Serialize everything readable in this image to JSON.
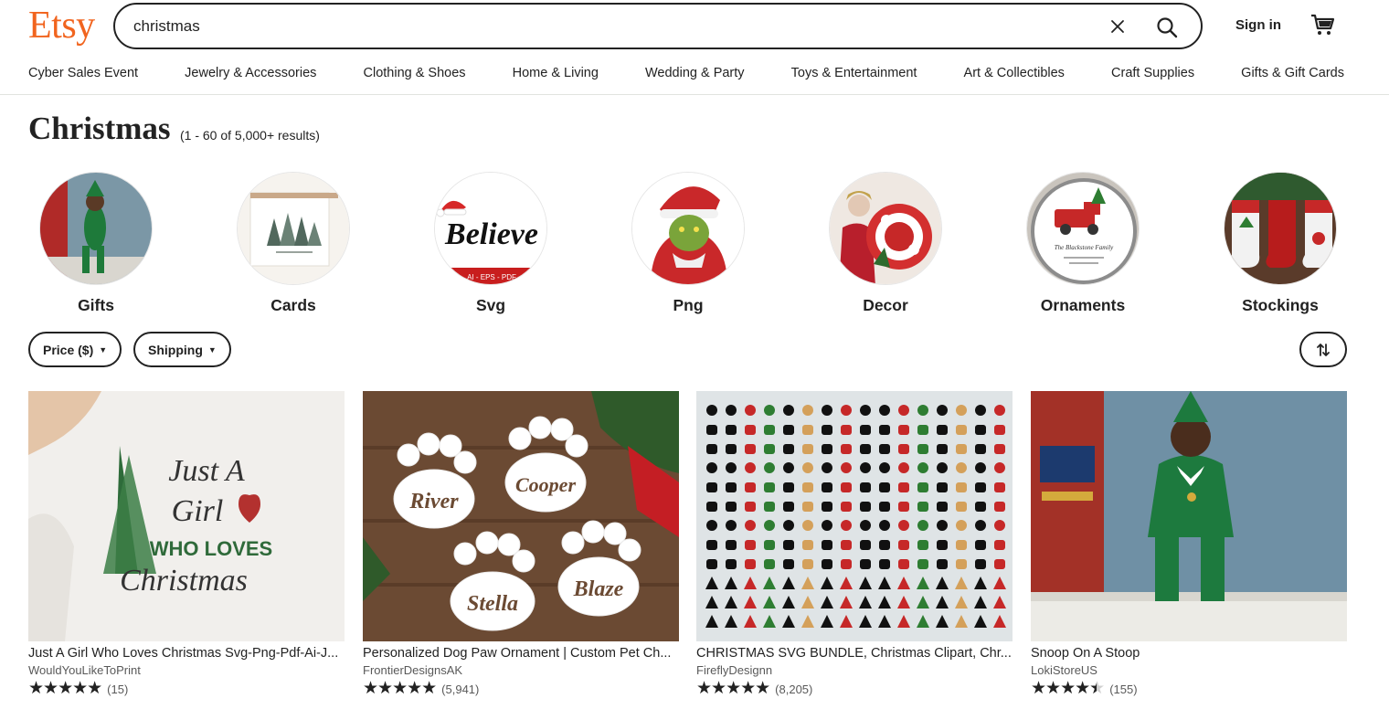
{
  "header": {
    "logo": "Etsy",
    "search_value": "christmas",
    "signin_label": "Sign in",
    "categories": [
      "Cyber Sales Event",
      "Jewelry & Accessories",
      "Clothing & Shoes",
      "Home & Living",
      "Wedding & Party",
      "Toys & Entertainment",
      "Art & Collectibles",
      "Craft Supplies",
      "Gifts & Gift Cards"
    ]
  },
  "page": {
    "title": "Christmas",
    "result_count": "(1 - 60 of 5,000+ results)"
  },
  "related": [
    {
      "label": "Gifts"
    },
    {
      "label": "Cards"
    },
    {
      "label": "Svg",
      "image_text": "Believe",
      "image_strip": "AI - EPS - PDF"
    },
    {
      "label": "Png"
    },
    {
      "label": "Decor"
    },
    {
      "label": "Ornaments",
      "image_text": "The Blackstone Family"
    },
    {
      "label": "Stockings"
    }
  ],
  "filters": {
    "price_label": "Price ($)",
    "shipping_label": "Shipping"
  },
  "products": [
    {
      "title": "Just A Girl Who Loves Christmas Svg-Png-Pdf-Ai-J...",
      "shop": "WouldYouLikeToPrint",
      "stars": 5,
      "reviews": "(15)",
      "image_text": [
        "Just A",
        "Girl",
        "WHO LOVES",
        "Christmas"
      ]
    },
    {
      "title": "Personalized Dog Paw Ornament | Custom Pet Ch...",
      "shop": "FrontierDesignsAK",
      "stars": 5,
      "reviews": "(5,941)",
      "image_text": [
        "River",
        "Cooper",
        "Stella",
        "Blaze"
      ]
    },
    {
      "title": "CHRISTMAS SVG BUNDLE, Christmas Clipart, Chr...",
      "shop": "FireflyDesignn",
      "stars": 5,
      "reviews": "(8,205)"
    },
    {
      "title": "Snoop On A Stoop",
      "shop": "LokiStoreUS",
      "stars": 4.5,
      "reviews": "(155)"
    }
  ],
  "colors": {
    "brand": "#f1641e",
    "text": "#222222",
    "muted": "#595959"
  }
}
